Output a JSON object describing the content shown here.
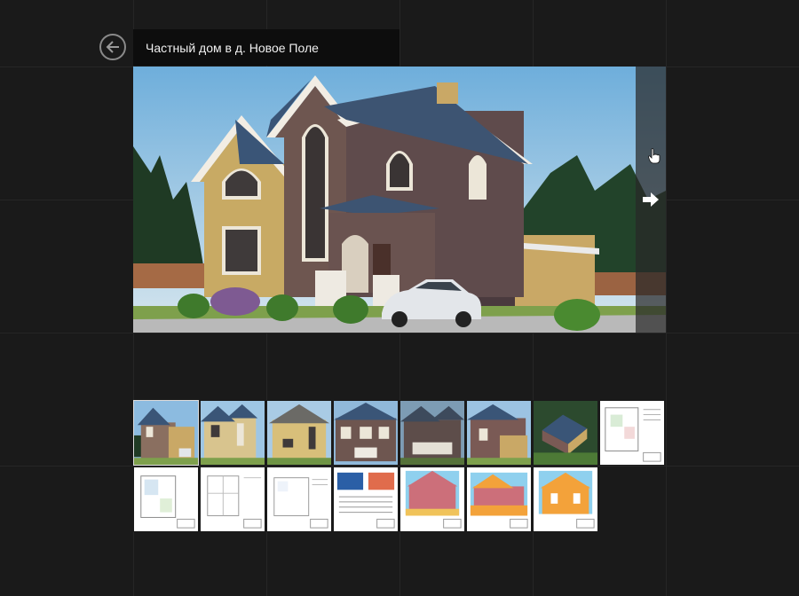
{
  "header": {
    "title": "Частный дом в д. Новое Поле",
    "back_icon": "arrow-left-circle-icon"
  },
  "viewer": {
    "next_icon": "arrow-right-icon",
    "cursor_icon": "hand-pointer-icon"
  },
  "thumbnails": [
    {
      "kind": "render-front",
      "active": true
    },
    {
      "kind": "render-front-light"
    },
    {
      "kind": "render-side-yellow"
    },
    {
      "kind": "render-rear-brick"
    },
    {
      "kind": "render-front-dusk"
    },
    {
      "kind": "render-side-brick"
    },
    {
      "kind": "render-aerial"
    },
    {
      "kind": "plan-sheet"
    },
    {
      "kind": "plan-sheet"
    },
    {
      "kind": "plan-sheet"
    },
    {
      "kind": "plan-sheet"
    },
    {
      "kind": "spec-sheet"
    },
    {
      "kind": "facade-pink"
    },
    {
      "kind": "facade-orange-long"
    },
    {
      "kind": "facade-orange"
    }
  ],
  "colors": {
    "background": "#1a1a1a",
    "title_bar": "#0d0d0d",
    "title_text": "#f0f0f0"
  }
}
